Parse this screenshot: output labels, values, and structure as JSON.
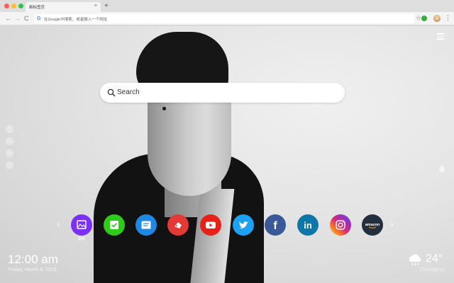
{
  "browser": {
    "tab_title": "新标签页",
    "tab_close": "×",
    "new_tab": "+",
    "nav_back": "←",
    "nav_forward": "→",
    "nav_reload": "C",
    "omnibox_icon": "G",
    "omnibox_placeholder": "在Google中搜索，或者输入一个网址",
    "star": "☆",
    "menu": "⋮"
  },
  "search": {
    "placeholder": "Search",
    "icon": "search-icon"
  },
  "shortcuts": [
    {
      "name": "gallery",
      "color": "#7b2ff7",
      "label": "图库"
    },
    {
      "name": "checklist",
      "color": "#2ecc1a"
    },
    {
      "name": "notes",
      "color": "#1e88e5"
    },
    {
      "name": "games",
      "color": "#e53935"
    },
    {
      "name": "youtube",
      "color": "#e62117"
    },
    {
      "name": "twitter",
      "color": "#1da1f2"
    },
    {
      "name": "facebook",
      "color": "#3b5998",
      "glyph": "f"
    },
    {
      "name": "linkedin",
      "color": "#0e76a8",
      "glyph": "in"
    },
    {
      "name": "instagram",
      "color": "#d62976"
    },
    {
      "name": "amazon",
      "color": "#232f3e",
      "glyph": "amazon"
    }
  ],
  "arrows": {
    "prev": "‹",
    "next": "›"
  },
  "clock": {
    "time": "12:00 am",
    "date": "Friday, March 8, 2019"
  },
  "weather": {
    "temp": "24°",
    "city": "Chongqing",
    "icon": "cloud-rain-icon"
  }
}
